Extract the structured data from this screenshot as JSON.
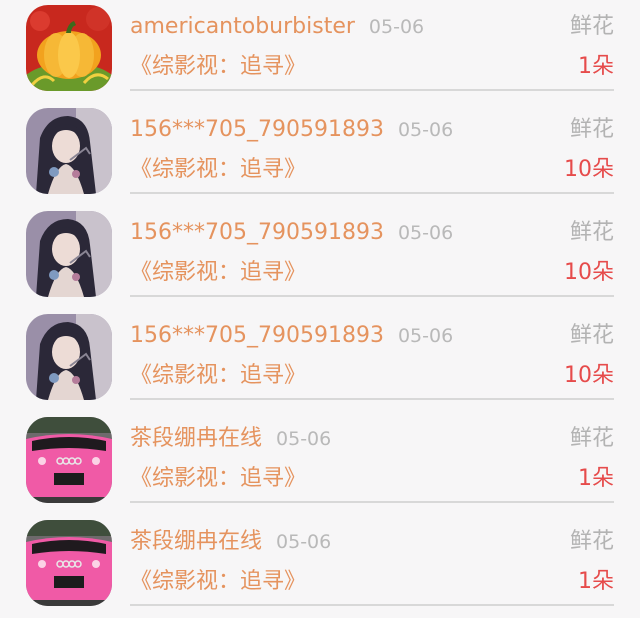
{
  "records": [
    {
      "user": "americantoburbister",
      "date": "05-06",
      "gift_type": "鲜花",
      "title": "《综影视：追寻》",
      "count": "1朵",
      "avatar": "pumpkin-avatar"
    },
    {
      "user": "156***705_790591893",
      "date": "05-06",
      "gift_type": "鲜花",
      "title": "《综影视：追寻》",
      "count": "10朵",
      "avatar": "anime-girl-avatar"
    },
    {
      "user": "156***705_790591893",
      "date": "05-06",
      "gift_type": "鲜花",
      "title": "《综影视：追寻》",
      "count": "10朵",
      "avatar": "anime-girl-avatar"
    },
    {
      "user": "156***705_790591893",
      "date": "05-06",
      "gift_type": "鲜花",
      "title": "《综影视：追寻》",
      "count": "10朵",
      "avatar": "anime-girl-avatar"
    },
    {
      "user": "茶段绷冉在线",
      "date": "05-06",
      "gift_type": "鲜花",
      "title": "《综影视：追寻》",
      "count": "1朵",
      "avatar": "pink-car-avatar"
    },
    {
      "user": "茶段绷冉在线",
      "date": "05-06",
      "gift_type": "鲜花",
      "title": "《综影视：追寻》",
      "count": "1朵",
      "avatar": "pink-car-avatar"
    }
  ]
}
